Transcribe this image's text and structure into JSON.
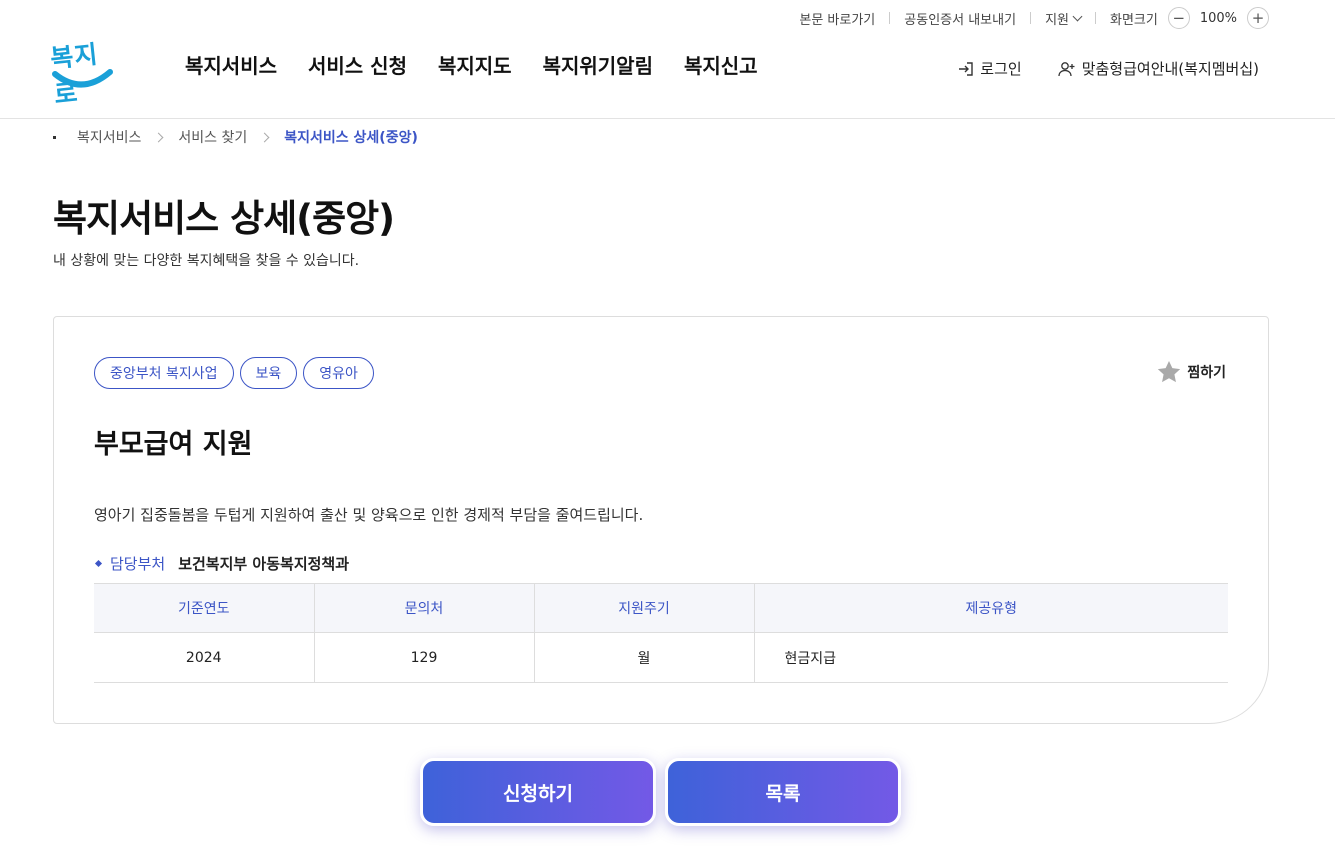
{
  "utility": {
    "skip_link": "본문 바로가기",
    "cert_export": "공동인증서 내보내기",
    "support": "지원",
    "screen_size": "화면크기",
    "zoom_level": "100%"
  },
  "logo": {
    "text": "복지로"
  },
  "nav": {
    "items": [
      "복지서비스",
      "서비스 신청",
      "복지지도",
      "복지위기알림",
      "복지신고"
    ]
  },
  "header": {
    "login": "로그인",
    "membership": "맞춤형급여안내(복지멤버십)"
  },
  "breadcrumb": [
    "복지서비스",
    "서비스 찾기",
    "복지서비스 상세(중앙)"
  ],
  "page": {
    "title": "복지서비스 상세(중앙)",
    "subtitle": "내 상황에 맞는 다양한 복지혜택을 찾을 수 있습니다."
  },
  "service": {
    "tags": [
      "중앙부처 복지사업",
      "보육",
      "영유아"
    ],
    "favorite": "찜하기",
    "title": "부모급여 지원",
    "description": "영아기 집중돌봄을 두텁게 지원하여 출산 및 양육으로 인한 경제적 부담을 줄여드립니다.",
    "dept_label": "담당부처",
    "dept_value": "보건복지부 아동복지정책과",
    "table": {
      "headers": [
        "기준연도",
        "문의처",
        "지원주기",
        "제공유형"
      ],
      "row": [
        "2024",
        "129",
        "월",
        "현금지급"
      ]
    }
  },
  "buttons": {
    "apply": "신청하기",
    "list": "목록"
  },
  "colors": {
    "accent": "#3c55c6",
    "logo": "#1aa0d8"
  }
}
